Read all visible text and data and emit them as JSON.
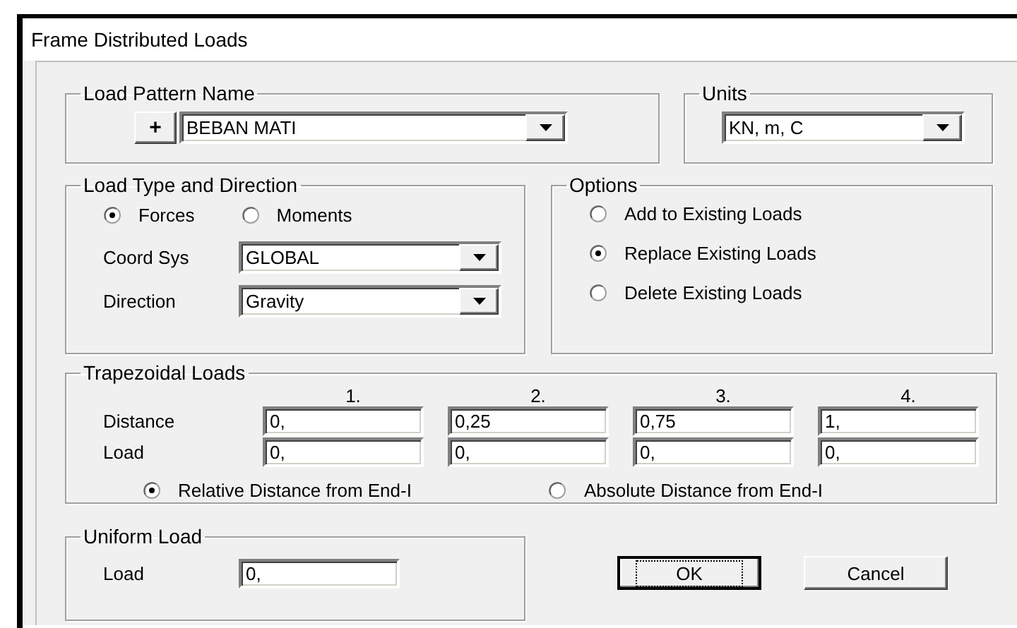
{
  "window": {
    "title": "Frame Distributed Loads"
  },
  "load_pattern": {
    "label": "Load Pattern Name",
    "add_button": "+",
    "value": "BEBAN MATI"
  },
  "units": {
    "label": "Units",
    "value": "KN, m, C"
  },
  "load_type": {
    "label": "Load Type and Direction",
    "types": [
      {
        "label": "Forces",
        "selected": true
      },
      {
        "label": "Moments",
        "selected": false
      }
    ],
    "coord_sys": {
      "label": "Coord Sys",
      "value": "GLOBAL"
    },
    "direction": {
      "label": "Direction",
      "value": "Gravity"
    }
  },
  "options": {
    "label": "Options",
    "items": [
      {
        "label": "Add to Existing Loads",
        "selected": false
      },
      {
        "label": "Replace Existing Loads",
        "selected": true
      },
      {
        "label": "Delete Existing Loads",
        "selected": false
      }
    ]
  },
  "trapezoidal": {
    "label": "Trapezoidal Loads",
    "columns": [
      "1.",
      "2.",
      "3.",
      "4."
    ],
    "rows": [
      {
        "label": "Distance",
        "values": [
          "0,",
          "0,25",
          "0,75",
          "1,"
        ]
      },
      {
        "label": "Load",
        "values": [
          "0,",
          "0,",
          "0,",
          "0,"
        ]
      }
    ],
    "distance_modes": [
      {
        "label": "Relative Distance from End-I",
        "selected": true
      },
      {
        "label": "Absolute Distance from End-I",
        "selected": false
      }
    ]
  },
  "uniform": {
    "label": "Uniform Load",
    "field_label": "Load",
    "value": "0,"
  },
  "buttons": [
    {
      "label": "OK",
      "focused": true
    },
    {
      "label": "Cancel",
      "focused": false
    }
  ]
}
